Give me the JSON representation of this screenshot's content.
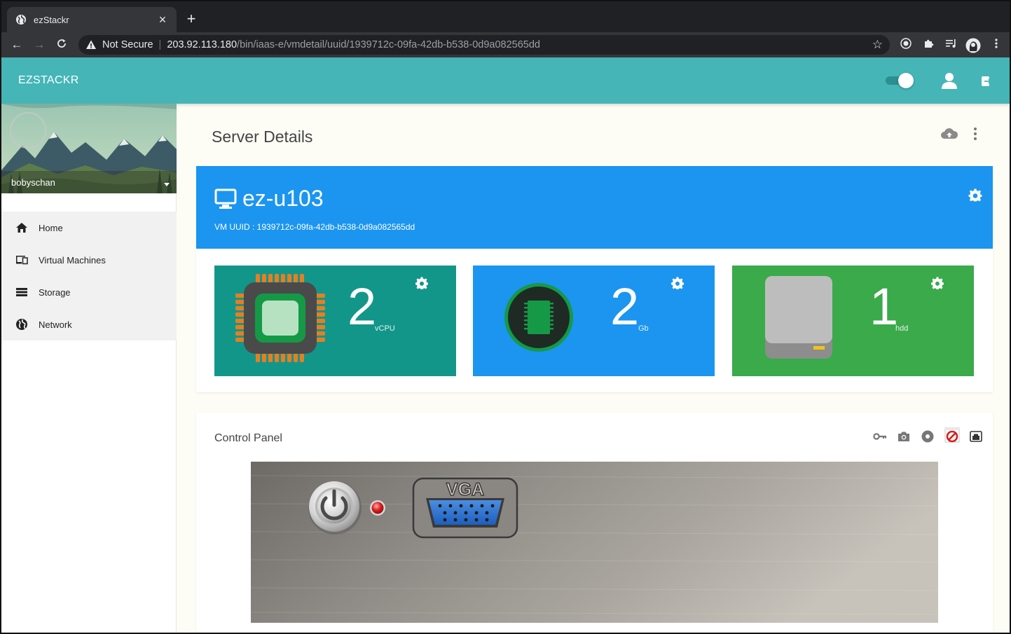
{
  "browser": {
    "tab_title": "ezStackr",
    "tab_close": "×",
    "new_tab": "+",
    "security_label": "Not Secure",
    "url_host": "203.92.113.180",
    "url_path": "/bin/iaas-e/vmdetail/uuid/1939712c-09fa-42db-b538-0d9a082565dd"
  },
  "app": {
    "brand": "EZSTACKR",
    "theme_toggle_on": true
  },
  "sidebar": {
    "username": "bobyschan",
    "items": [
      {
        "label": "Home",
        "icon": "home-icon"
      },
      {
        "label": "Virtual Machines",
        "icon": "devices-icon"
      },
      {
        "label": "Storage",
        "icon": "storage-icon"
      },
      {
        "label": "Network",
        "icon": "globe-icon"
      }
    ]
  },
  "main": {
    "title": "Server Details",
    "vm": {
      "name": "ez-u103",
      "uuid_label": "VM UUID : 1939712c-09fa-42db-b538-0d9a082565dd"
    },
    "stats": [
      {
        "value": "2",
        "unit": "vCPU",
        "color": "#13968a",
        "icon": "cpu-chip-icon"
      },
      {
        "value": "2",
        "unit": "Gb",
        "color": "#1b95f0",
        "icon": "memory-icon"
      },
      {
        "value": "1",
        "unit": "hdd",
        "color": "#3aaa4b",
        "icon": "hard-disk-icon"
      }
    ],
    "control_panel": {
      "title": "Control Panel",
      "vga_label": "VGA",
      "tools": [
        "key-icon",
        "camera-icon",
        "disc-icon",
        "no-access-icon",
        "console-icon"
      ]
    }
  },
  "colors": {
    "appbar": "#45b5b7",
    "vm_card": "#1b95f0",
    "power_led": "#e02020"
  }
}
